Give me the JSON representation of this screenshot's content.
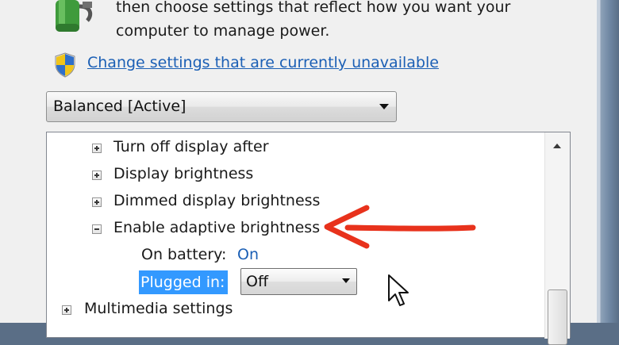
{
  "intro": {
    "line1": "then choose settings that reflect how you want your",
    "line2": "computer to manage power."
  },
  "change_link": "Change settings that are currently unavailable",
  "plan_select": {
    "value": "Balanced [Active]"
  },
  "tree": {
    "items": [
      {
        "label": "Turn off display after",
        "state": "collapsed"
      },
      {
        "label": "Display brightness",
        "state": "collapsed"
      },
      {
        "label": "Dimmed display brightness",
        "state": "collapsed"
      },
      {
        "label": "Enable adaptive brightness",
        "state": "expanded"
      }
    ],
    "on_battery": {
      "label": "On battery:",
      "value": "On"
    },
    "plugged_in": {
      "label": "Plugged in:",
      "value": "Off"
    },
    "multimedia": {
      "label": "Multimedia settings",
      "state": "collapsed"
    }
  },
  "icons": {
    "app": "power-plug-battery-icon",
    "shield": "uac-shield-icon",
    "cursor": "mouse-pointer-icon"
  },
  "colors": {
    "link": "#1b5fb5",
    "selection": "#3399ff",
    "annotation_arrow": "#e8321c",
    "window_bg": "#f0f0f0"
  }
}
